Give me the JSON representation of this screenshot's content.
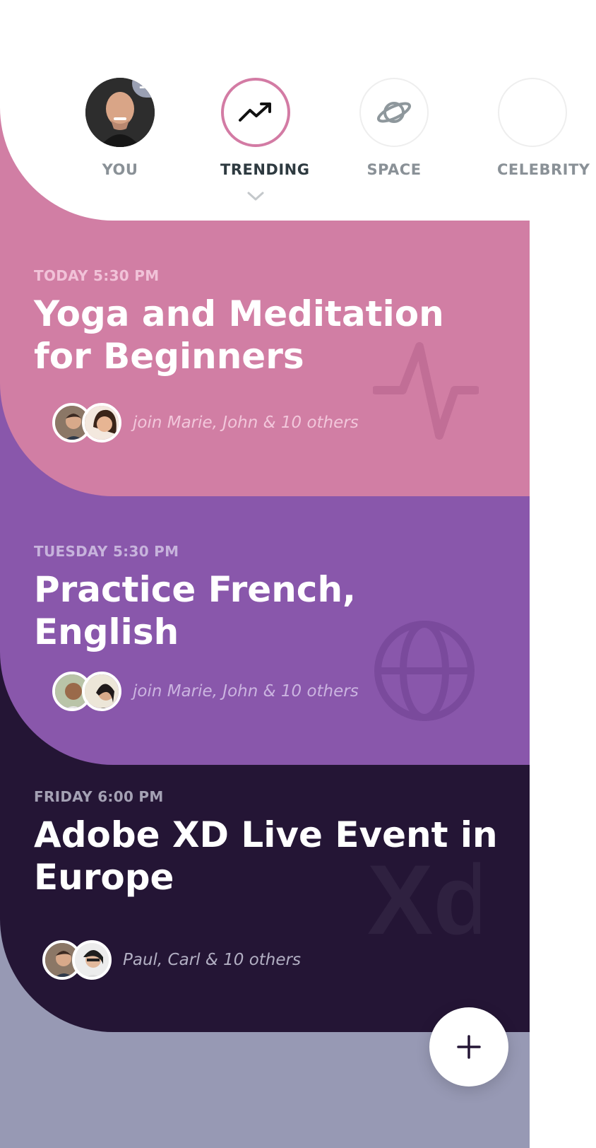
{
  "categories": [
    {
      "label": "YOU",
      "badge": "12",
      "icon": "user-avatar"
    },
    {
      "label": "TRENDING",
      "icon": "trending-up-icon",
      "selected": true
    },
    {
      "label": "SPACE",
      "icon": "planet-icon"
    },
    {
      "label": "CELEBRITY",
      "icon": ""
    }
  ],
  "events": [
    {
      "date": "TODAY 5:30 PM",
      "title": "Yoga and Meditation for Beginners",
      "participants": "join Marie, John & 10 others",
      "icon": "pulse-icon",
      "color": "#d17ea4"
    },
    {
      "date": "TUESDAY 5:30 PM",
      "title": "Practice French, English",
      "participants": "join Marie, John & 10 others",
      "icon": "globe-icon",
      "color": "#8957ab"
    },
    {
      "date": "FRIDAY 6:00 PM",
      "title": "Adobe XD Live Event in Europe",
      "participants": "Paul, Carl & 10 others",
      "icon": "xd-logo-icon",
      "color": "#241535"
    }
  ],
  "fab": {
    "icon": "plus-icon"
  },
  "colors": {
    "pink": "#d17ea4",
    "purple": "#8957ab",
    "dark": "#241535",
    "lavender": "#9799b4"
  }
}
